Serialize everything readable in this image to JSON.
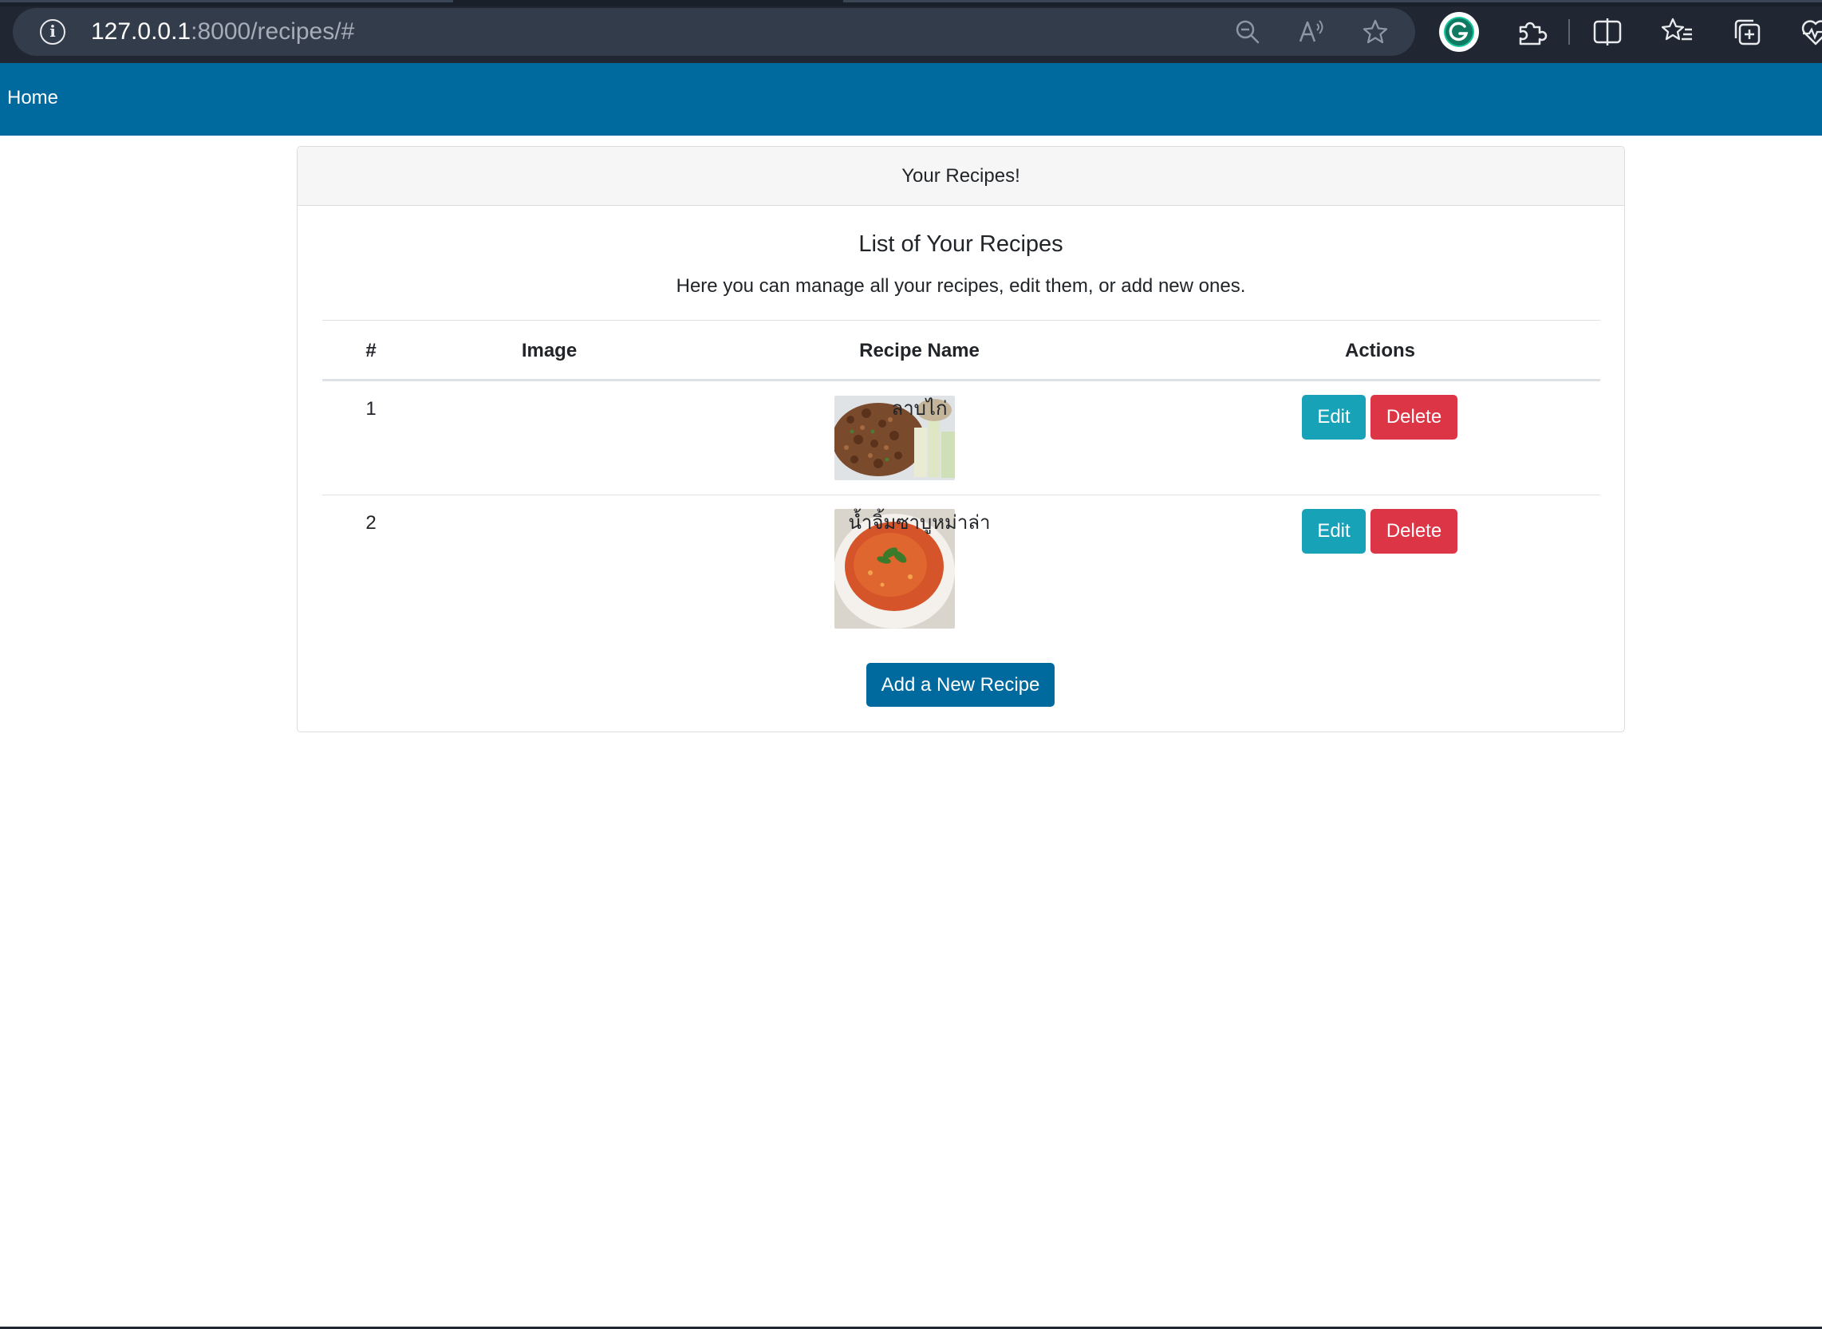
{
  "browser": {
    "url_host": "127.0.0.1",
    "url_path": ":8000/recipes/#"
  },
  "navbar": {
    "home_label": "Home"
  },
  "card": {
    "header": "Your Recipes!",
    "title": "List of Your Recipes",
    "subtitle": "Here you can manage all your recipes, edit them, or add new ones."
  },
  "table": {
    "columns": [
      "#",
      "Image",
      "Recipe Name",
      "Actions"
    ],
    "rows": [
      {
        "index": "1",
        "name": "ลาบไก่",
        "image": "larb-chicken-photo",
        "edit_label": "Edit",
        "delete_label": "Delete"
      },
      {
        "index": "2",
        "name": "น้ำจิ้มซาบูหม่าล่า",
        "image": "mala-sauce-bowl-photo",
        "edit_label": "Edit",
        "delete_label": "Delete"
      }
    ]
  },
  "add_button_label": "Add a New Recipe",
  "colors": {
    "navbar": "#006a9f",
    "edit": "#17a2b8",
    "delete": "#dc3545",
    "primary": "#006a9f"
  }
}
